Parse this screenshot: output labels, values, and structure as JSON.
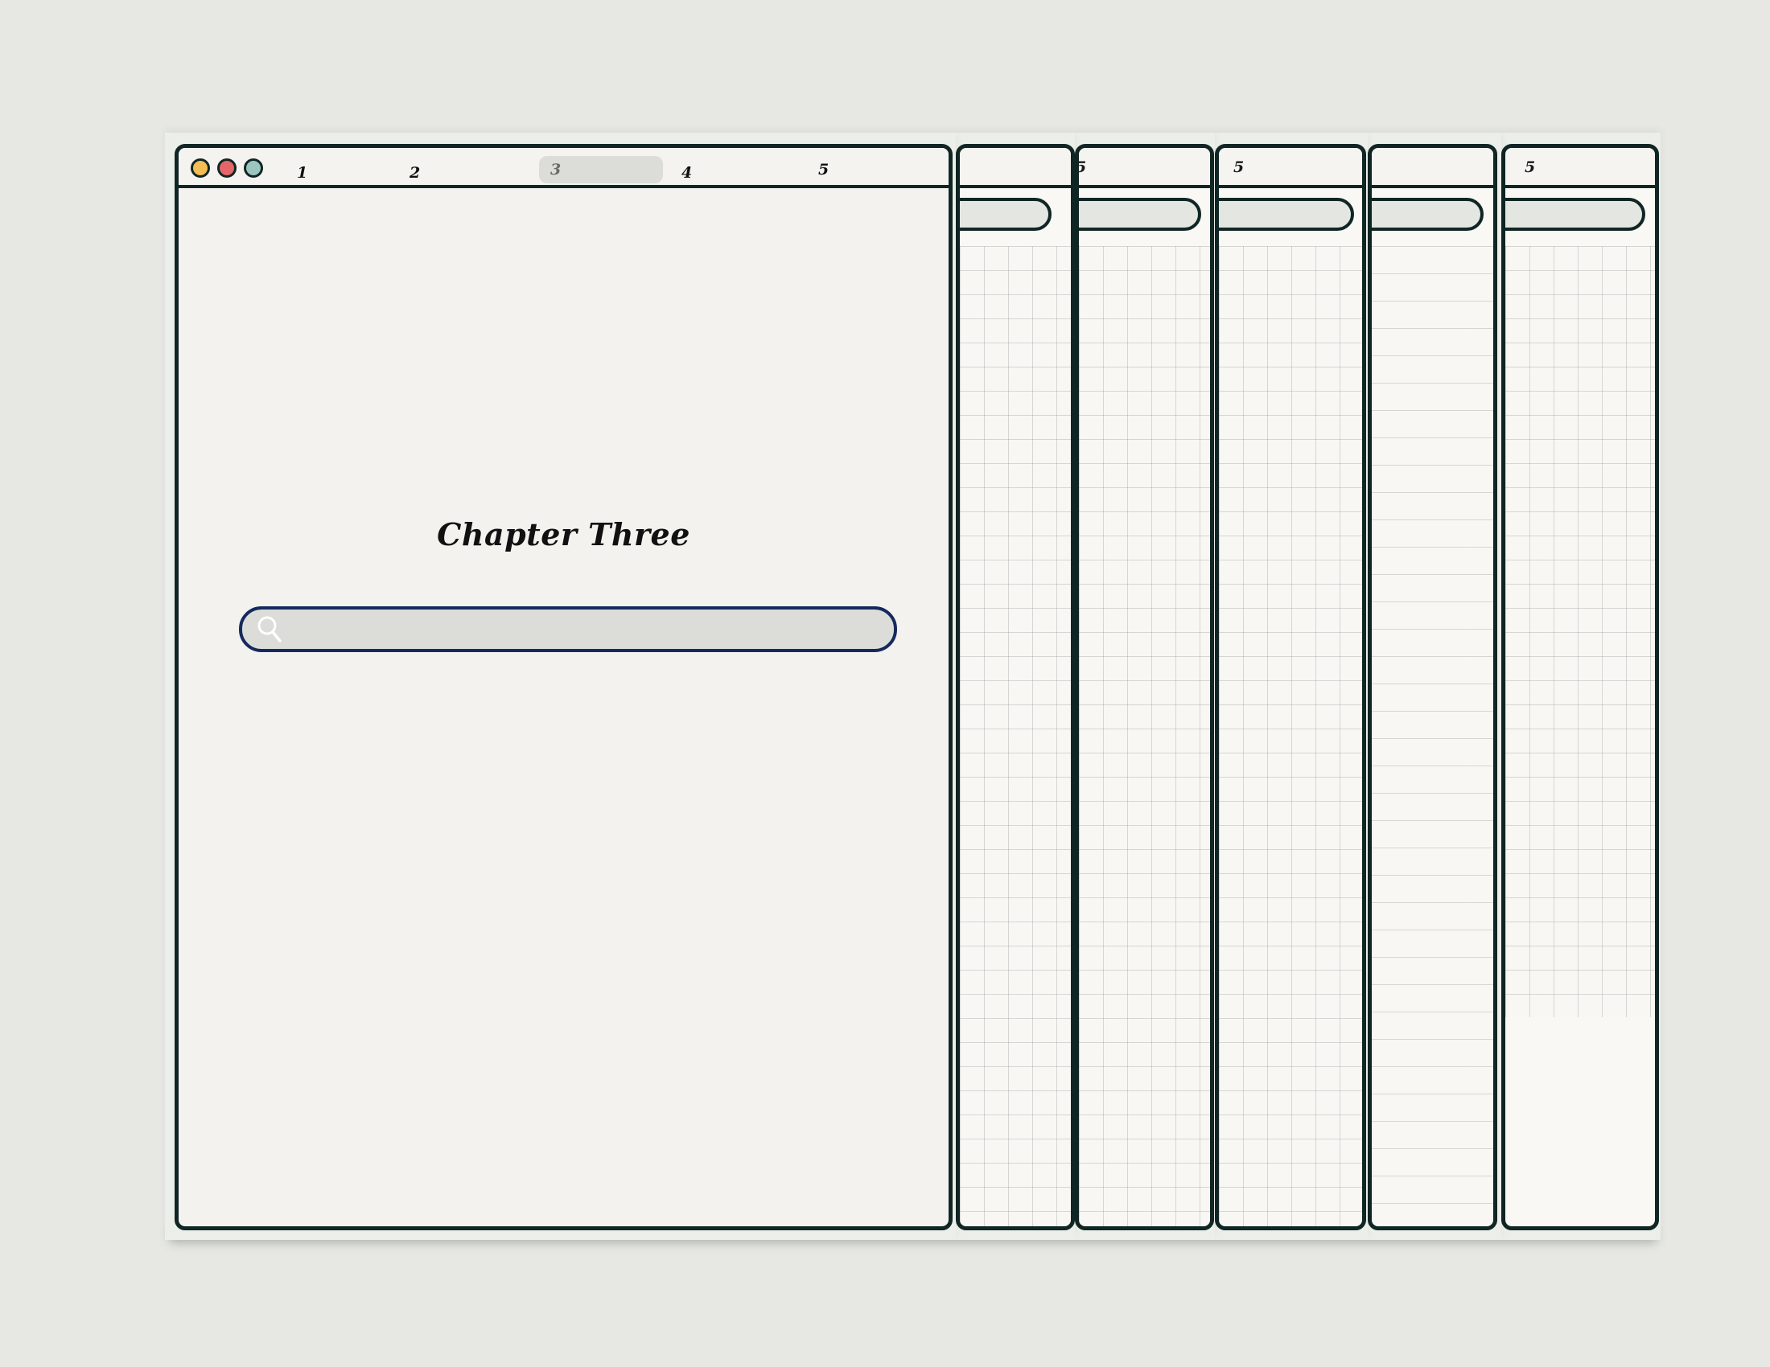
{
  "window": {
    "controls": [
      {
        "name": "minimize",
        "color": "#f3bd55"
      },
      {
        "name": "close",
        "color": "#e4656a"
      },
      {
        "name": "maximize",
        "color": "#9bc5bd"
      }
    ],
    "tabs": [
      {
        "label": "1",
        "active": false
      },
      {
        "label": "2",
        "active": false
      },
      {
        "label": "3",
        "active": true
      },
      {
        "label": "4",
        "active": false
      },
      {
        "label": "5",
        "active": false
      }
    ]
  },
  "main": {
    "title": "Chapter Three",
    "search": {
      "placeholder": "",
      "value": "",
      "icon": "search-icon"
    }
  },
  "background_windows": [
    {
      "visible_tab": "",
      "paper": "grid"
    },
    {
      "visible_tab": "5",
      "paper": "grid"
    },
    {
      "visible_tab": "5",
      "paper": "grid"
    },
    {
      "visible_tab": "",
      "paper": "lined"
    },
    {
      "visible_tab": "5",
      "paper": "grid"
    }
  ],
  "colors": {
    "frame": "#102624",
    "search_border": "#142a5e",
    "active_tab_bg": "#dcddd8"
  }
}
